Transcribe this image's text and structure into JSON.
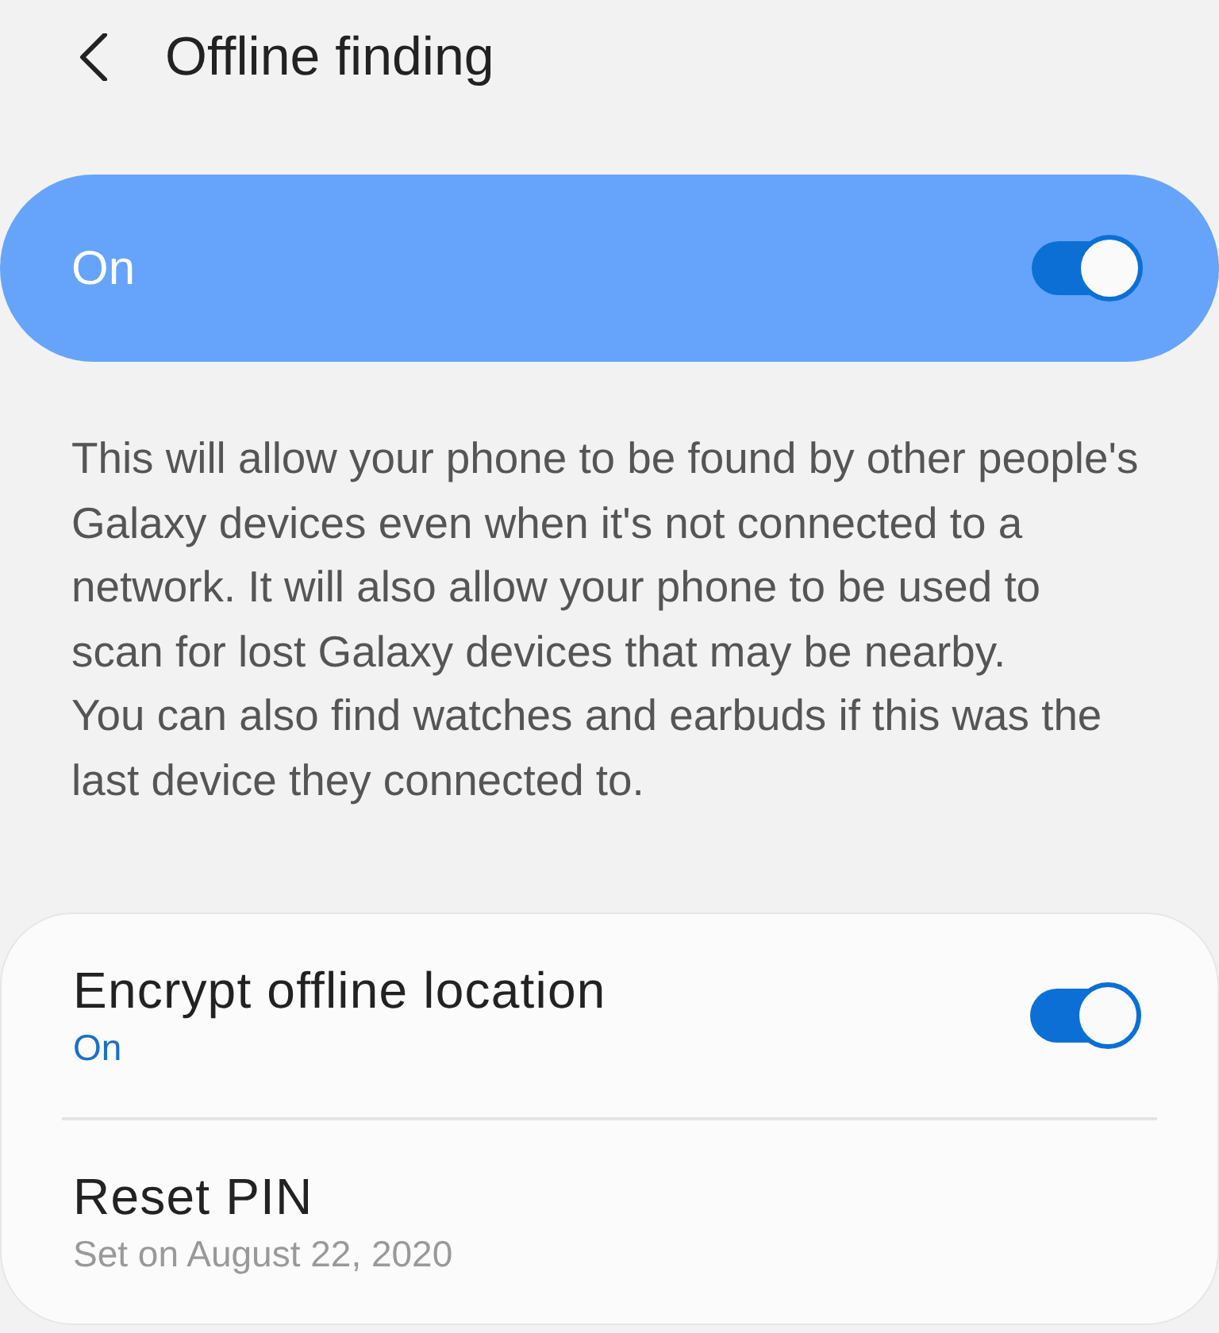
{
  "header": {
    "title": "Offline finding"
  },
  "master_switch": {
    "label": "On",
    "on": true
  },
  "description": [
    "This will allow your phone to be found by other people's Galaxy devices even when it's not connected to a network. It will also allow your phone to be used to scan for lost Galaxy devices that may be nearby.",
    "You can also find watches and earbuds if this was the last device they connected to."
  ],
  "settings": [
    {
      "kind": "switch",
      "title": "Encrypt offline location",
      "summary": "On",
      "on": true
    },
    {
      "kind": "link",
      "title": "Reset PIN",
      "summary": "Set on August 22, 2020"
    }
  ]
}
